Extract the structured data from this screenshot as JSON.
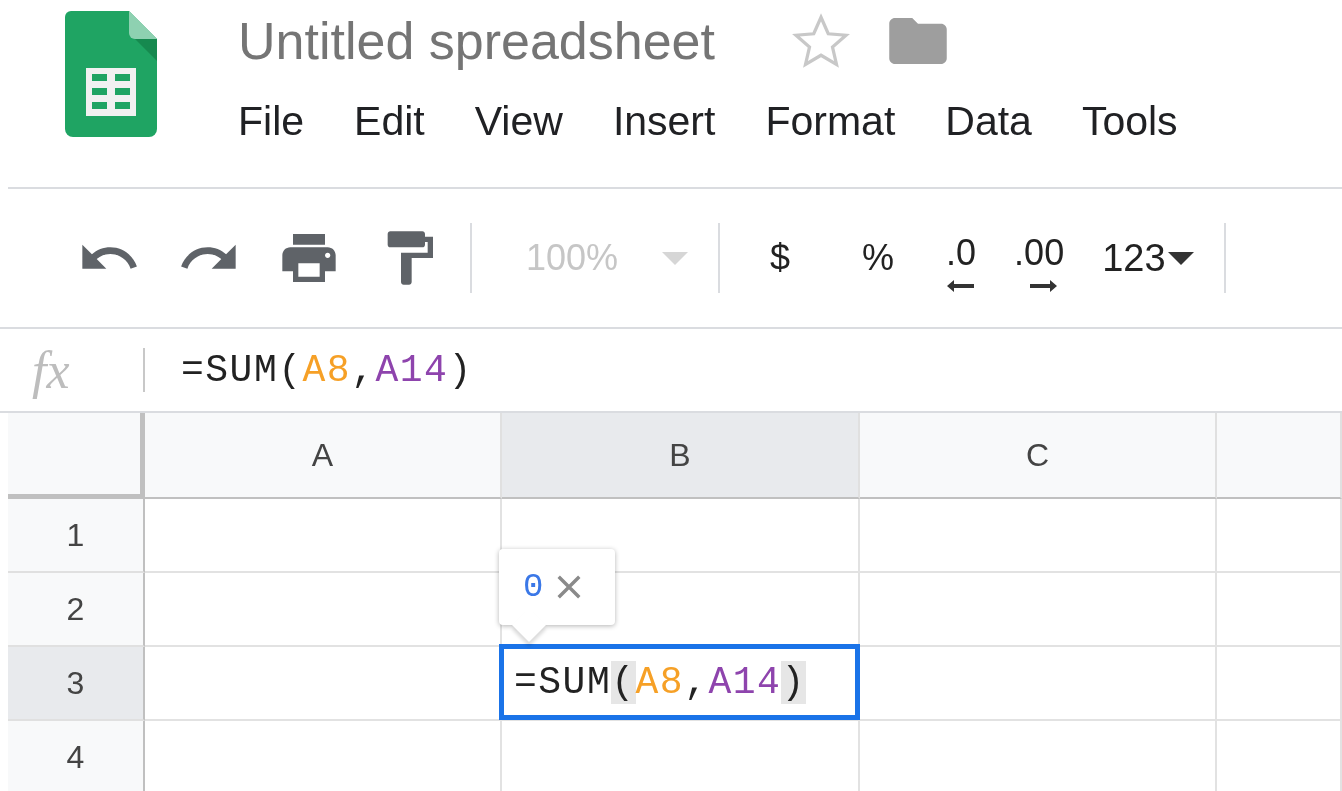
{
  "document": {
    "title": "Untitled spreadsheet",
    "starred": false
  },
  "menu": [
    "File",
    "Edit",
    "View",
    "Insert",
    "Format",
    "Data",
    "Tools"
  ],
  "toolbar": [
    [
      {
        "kind": "undo"
      },
      {
        "kind": "redo"
      },
      {
        "kind": "print"
      },
      {
        "kind": "paint_format"
      }
    ],
    [
      {
        "kind": "zoom",
        "label": "100%",
        "disabled": true
      }
    ],
    [
      {
        "kind": "text",
        "label": "$"
      },
      {
        "kind": "text",
        "label": "%"
      },
      {
        "kind": "decimal_decrease",
        "label": ".0"
      },
      {
        "kind": "decimal_increase",
        "label": ".00"
      },
      {
        "kind": "format",
        "label": "123"
      }
    ]
  ],
  "formula_bar": {
    "label": "fx",
    "formula": [
      {
        "text": "=SUM",
        "kind": "plain"
      },
      {
        "text": "(",
        "kind": "paren"
      },
      {
        "text": "A8",
        "kind": "ref",
        "color": "#f6a026"
      },
      {
        "text": ",",
        "kind": "plain"
      },
      {
        "text": "A14",
        "kind": "ref",
        "color": "#8e44ad"
      },
      {
        "text": ")",
        "kind": "paren"
      }
    ]
  },
  "columns": [
    {
      "label": "A",
      "selected": false
    },
    {
      "label": "B",
      "selected": true
    },
    {
      "label": "C",
      "selected": false
    }
  ],
  "rows": [
    {
      "label": "1",
      "selected": false
    },
    {
      "label": "2",
      "selected": false
    },
    {
      "label": "3",
      "selected": true
    },
    {
      "label": "4",
      "selected": false
    }
  ],
  "active_cell": {
    "formula": [
      {
        "text": "=SUM",
        "kind": "plain"
      },
      {
        "text": "(",
        "kind": "paren"
      },
      {
        "text": "A8",
        "kind": "ref",
        "color": "#f6a026"
      },
      {
        "text": ",",
        "kind": "plain"
      },
      {
        "text": "A14",
        "kind": "ref",
        "color": "#8e44ad"
      },
      {
        "text": ")",
        "kind": "paren"
      }
    ]
  },
  "result_tooltip": {
    "value": "0"
  }
}
